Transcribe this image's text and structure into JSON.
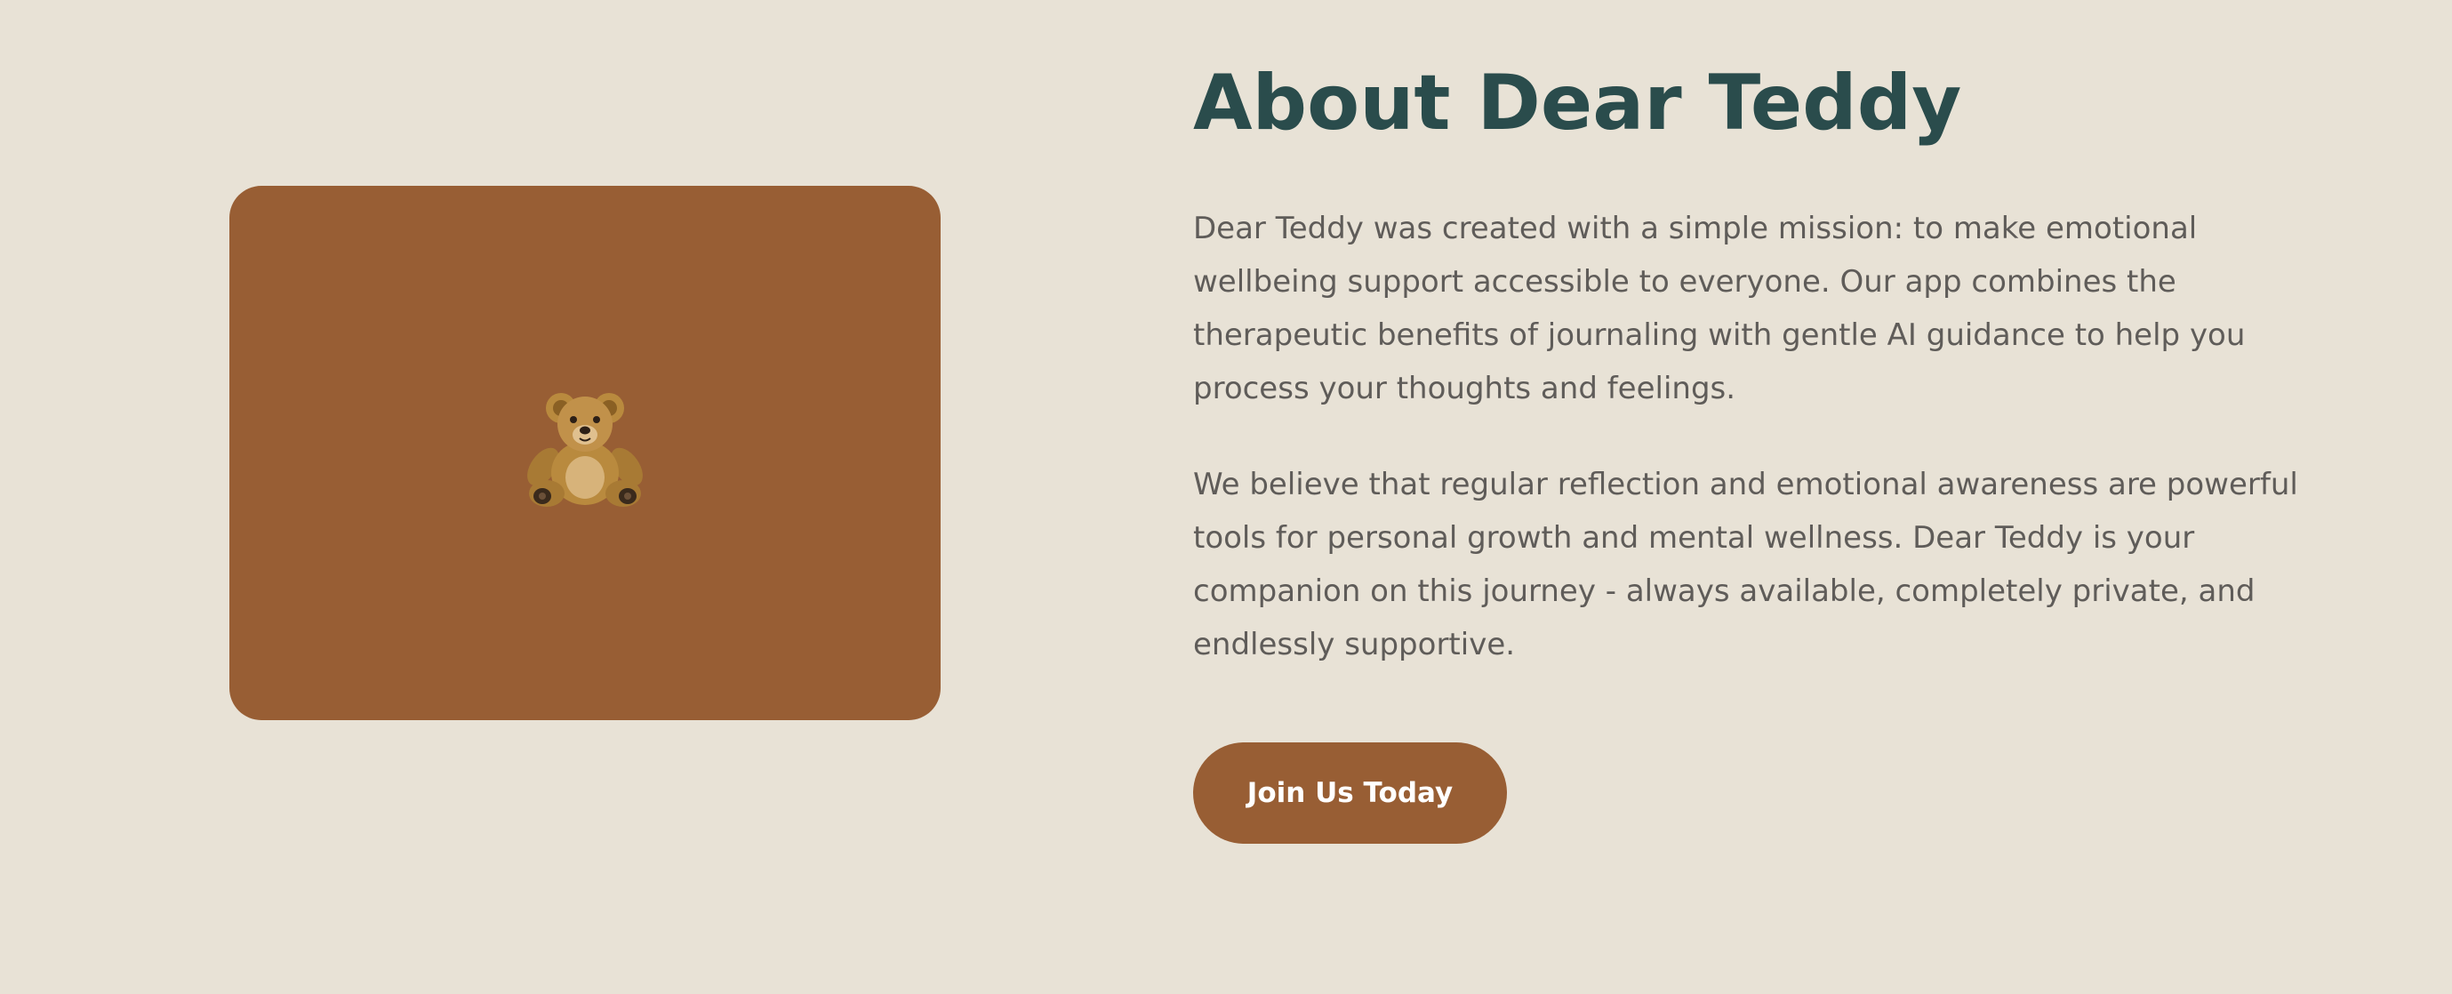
{
  "about": {
    "title": "About Dear Teddy",
    "paragraphs": [
      "Dear Teddy was created with a simple mission: to make emotional wellbeing support accessible to everyone. Our app combines the therapeutic benefits of journaling with gentle AI guidance to help you process your thoughts and feelings.",
      "We believe that regular reflection and emotional awareness are powerful tools for personal growth and mental wellness. Dear Teddy is your companion on this journey - always available, completely private, and endlessly supportive."
    ],
    "cta_label": "Join Us Today"
  },
  "image": {
    "icon": "teddy-bear-icon"
  },
  "colors": {
    "background": "#e8e2d6",
    "accent": "#985e34",
    "heading": "#2a4c4c",
    "body_text": "#5f5c59",
    "button_text": "#ffffff"
  }
}
